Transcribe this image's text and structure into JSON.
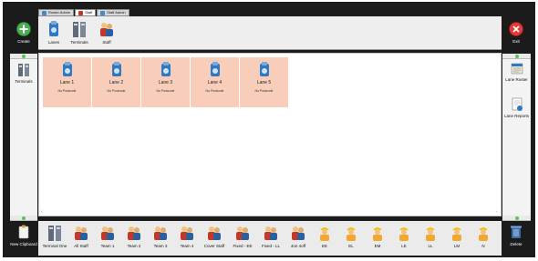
{
  "tabs": [
    {
      "label": "Roster Admin"
    },
    {
      "label": "Staff"
    },
    {
      "label": "Staff Admin"
    }
  ],
  "corner": {
    "create_label": "Create",
    "exit_label": "Exit",
    "new_clipboard_label": "New Clipboard",
    "delete_label": "Delete"
  },
  "toolbar": [
    {
      "label": "Lanes",
      "icon": "lane-icon"
    },
    {
      "label": "Terminals",
      "icon": "terminal-icon"
    },
    {
      "label": "Staff",
      "icon": "staff-icon"
    }
  ],
  "leftbar": {
    "items": [
      {
        "label": "Terminals",
        "icon": "terminal-icon"
      }
    ]
  },
  "rightbar": {
    "items": [
      {
        "label": "Lane Roster",
        "icon": "roster-icon"
      },
      {
        "label": "Lane Reports",
        "icon": "report-icon"
      }
    ]
  },
  "lanes": [
    {
      "title": "Lane 1",
      "sub": "No Postcode"
    },
    {
      "title": "Lane 2",
      "sub": "No Postcode"
    },
    {
      "title": "Lane 3",
      "sub": "No Postcode"
    },
    {
      "title": "Lane 4",
      "sub": "No Postcode"
    },
    {
      "title": "Lane 5",
      "sub": "No Postcode"
    }
  ],
  "bottom": [
    {
      "label": "Terminal One",
      "icon": "terminal-icon"
    },
    {
      "label": "All Staff",
      "icon": "staff-icon"
    },
    {
      "label": "Team 1",
      "icon": "staff-icon"
    },
    {
      "label": "Team 2",
      "icon": "staff-icon"
    },
    {
      "label": "Team 3",
      "icon": "staff-icon"
    },
    {
      "label": "Team 4",
      "icon": "staff-icon"
    },
    {
      "label": "Cover Staff",
      "icon": "staff-icon"
    },
    {
      "label": "Fixed - EE",
      "icon": "staff-icon"
    },
    {
      "label": "Fixed - LL",
      "icon": "staff-icon"
    },
    {
      "label": "4on 4off",
      "icon": "staff-icon"
    },
    {
      "label": "EE",
      "icon": "worker-icon"
    },
    {
      "label": "EL",
      "icon": "worker-icon"
    },
    {
      "label": "EM",
      "icon": "worker-icon"
    },
    {
      "label": "LE",
      "icon": "worker-icon"
    },
    {
      "label": "LL",
      "icon": "worker-icon"
    },
    {
      "label": "LM",
      "icon": "worker-icon"
    },
    {
      "label": "N",
      "icon": "worker-icon"
    }
  ],
  "colors": {
    "frame": "#1b1b1b",
    "lane_tile": "#f8cebb",
    "create_green": "#4caf50",
    "exit_red": "#e23b3b"
  }
}
